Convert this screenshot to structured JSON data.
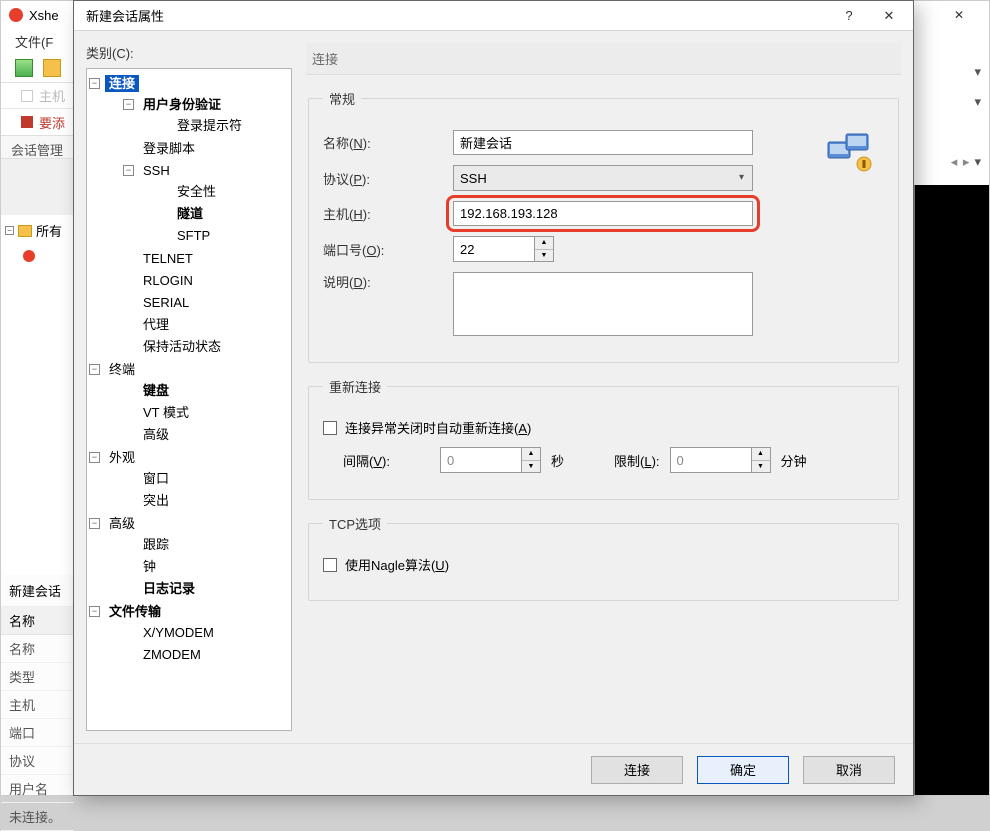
{
  "bg": {
    "app_title": "Xshe",
    "menu_file": "文件(F",
    "host_placeholder": "主机",
    "tab_label": "要添",
    "session_mgr": "会话管理",
    "tree_root": "所有",
    "close_x": "✕",
    "props": {
      "title": "新建会话",
      "name_head": "名称",
      "rows": [
        "名称",
        "类型",
        "主机",
        "端口",
        "协议",
        "用户名"
      ],
      "status": "未连接。"
    }
  },
  "dialog": {
    "title": "新建会话属性",
    "help": "?",
    "close": "✕",
    "category_label": "类别(C):",
    "right_head": "连接",
    "tree": {
      "connection": "连接",
      "auth": "用户身份验证",
      "login_prompt": "登录提示符",
      "login_script": "登录脚本",
      "ssh": "SSH",
      "security": "安全性",
      "tunnel": "隧道",
      "sftp": "SFTP",
      "telnet": "TELNET",
      "rlogin": "RLOGIN",
      "serial": "SERIAL",
      "proxy": "代理",
      "keepalive": "保持活动状态",
      "terminal": "终端",
      "keyboard": "键盘",
      "vt": "VT 模式",
      "term_adv": "高级",
      "appearance": "外观",
      "window": "窗口",
      "highlight_appear": "突出",
      "advanced": "高级",
      "trace": "跟踪",
      "bell": "钟",
      "log": "日志记录",
      "filetrans": "文件传输",
      "xy": "X/YMODEM",
      "z": "ZMODEM"
    },
    "general": {
      "legend": "常规",
      "name_label_pre": "名称(",
      "name_label_u": "N",
      "name_label_post": "):",
      "name_value": "新建会话",
      "proto_label_pre": "协议(",
      "proto_label_u": "P",
      "proto_label_post": "):",
      "proto_value": "SSH",
      "host_label_pre": "主机(",
      "host_label_u": "H",
      "host_label_post": "):",
      "host_value": "192.168.193.128",
      "port_label_pre": "端口号(",
      "port_label_u": "O",
      "port_label_post": "):",
      "port_value": "22",
      "desc_label_pre": "说明(",
      "desc_label_u": "D",
      "desc_label_post": "):"
    },
    "reconnect": {
      "legend": "重新连接",
      "auto_label_pre": "连接异常关闭时自动重新连接(",
      "auto_label_u": "A",
      "auto_label_post": ")",
      "interval_label_pre": "间隔(",
      "interval_label_u": "V",
      "interval_label_post": "):",
      "interval_value": "0",
      "interval_unit": "秒",
      "limit_label_pre": "限制(",
      "limit_label_u": "L",
      "limit_label_post": "):",
      "limit_value": "0",
      "limit_unit": "分钟"
    },
    "tcp": {
      "legend": "TCP选项",
      "nagle_pre": "使用Nagle算法(",
      "nagle_u": "U",
      "nagle_post": ")"
    },
    "buttons": {
      "connect": "连接",
      "ok": "确定",
      "cancel": "取消"
    }
  }
}
